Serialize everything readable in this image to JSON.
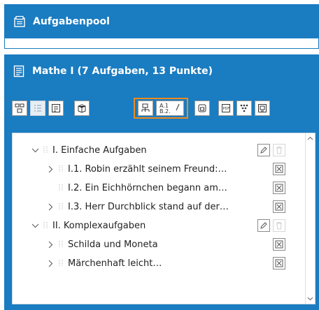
{
  "pool": {
    "title": "Aufgabenpool",
    "icon": "pool-icon"
  },
  "collection": {
    "title": "Mathe I (7 Aufgaben, 13 Punkte)",
    "icon": "document-icon"
  },
  "toolbar": {
    "icons": [
      "structure-icon",
      "list-icon",
      "task-sheet-icon",
      "box-icon",
      "add-task-icon",
      "numbering-icon",
      "preview-icon",
      "pdf-export-icon",
      "network-icon",
      "screen-export-icon"
    ],
    "highlight_color": "#f08a1c"
  },
  "tree": {
    "items": [
      {
        "label": "I. Einfache Aufgaben",
        "level": 0,
        "type": "group"
      },
      {
        "label": "I.1. Robin erzählt seinem Freund:…",
        "level": 1,
        "type": "task",
        "collapsible": true
      },
      {
        "label": "I.2. Ein Eichhörnchen begann am…",
        "level": 1,
        "type": "task",
        "collapsible": false
      },
      {
        "label": "I.3. Herr Durchblick stand auf der…",
        "level": 1,
        "type": "task",
        "collapsible": true
      },
      {
        "label": "II. Komplexaufgaben",
        "level": 0,
        "type": "group"
      },
      {
        "label": "Schilda und Moneta",
        "level": 1,
        "type": "task",
        "collapsible": true
      },
      {
        "label": "Märchenhaft leicht…",
        "level": 1,
        "type": "task",
        "collapsible": true
      }
    ]
  },
  "colors": {
    "header_blue": "#1a7cc1",
    "accent_orange": "#f08a1c"
  }
}
